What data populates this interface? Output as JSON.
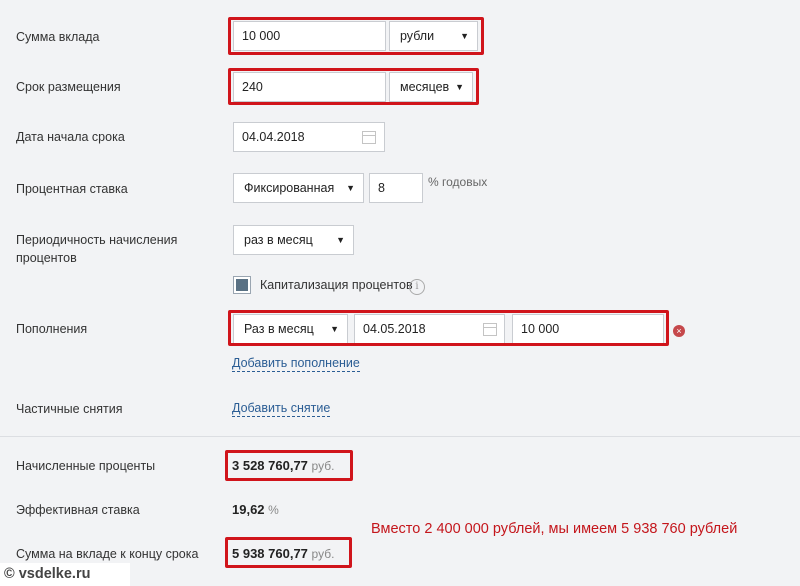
{
  "labels": {
    "sum": "Сумма вклада",
    "term": "Срок размещения",
    "start_date": "Дата начала срока",
    "rate": "Процентная ставка",
    "periodicity_line1": "Периодичность начисления",
    "periodicity_line2": "процентов",
    "capitalization": "Капитализация процентов",
    "replenish": "Пополнения",
    "withdraw": "Частичные снятия",
    "accrued": "Начисленные проценты",
    "effective": "Эффективная ставка",
    "total": "Сумма на вкладе к концу срока"
  },
  "fields": {
    "sum_value": "10 000",
    "currency": "рубли",
    "term_value": "240",
    "term_unit": "месяцев",
    "start_date": "04.04.2018",
    "rate_type": "Фиксированная",
    "rate_value": "8",
    "rate_unit": "% годовых",
    "periodicity": "раз в месяц",
    "capitalization_checked": true,
    "replenish_period": "Раз в месяц",
    "replenish_date": "04.05.2018",
    "replenish_amount": "10 000"
  },
  "links": {
    "add_replenish": "Добавить пополнение",
    "add_withdraw": "Добавить снятие"
  },
  "results": {
    "accrued_value": "3 528 760,77",
    "accrued_unit": "руб.",
    "effective_value": "19,62",
    "effective_unit": "%",
    "total_value": "5 938 760,77",
    "total_unit": "руб."
  },
  "annotation": "Вместо 2 400 000 рублей, мы имеем 5 938 760 рублей",
  "watermark": "vsdelke.ru",
  "colors": {
    "highlight": "#d0141b",
    "link": "#2b5d94",
    "note": "#c4161c"
  }
}
